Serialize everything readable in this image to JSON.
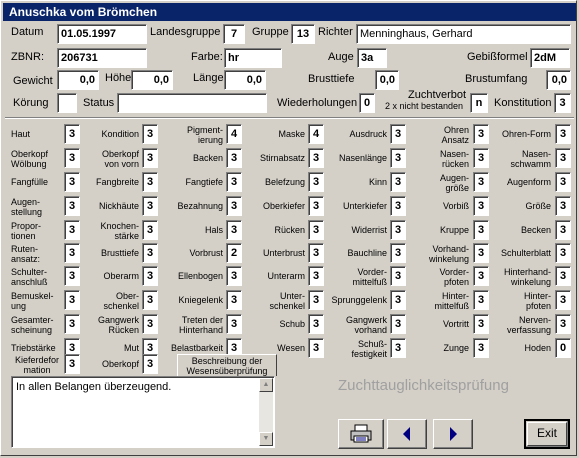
{
  "window": {
    "title": "Anuschka vom Brömchen"
  },
  "header": {
    "datum": {
      "label": "Datum",
      "value": "01.05.1997"
    },
    "landesgruppe": {
      "label": "Landesgruppe",
      "value": "7"
    },
    "gruppe": {
      "label": "Gruppe",
      "value": "13"
    },
    "richter": {
      "label": "Richter",
      "value": "Menninghaus, Gerhard"
    },
    "zbnr": {
      "label": "ZBNR:",
      "value": "206731"
    },
    "farbe": {
      "label": "Farbe:",
      "value": "hr"
    },
    "auge": {
      "label": "Auge",
      "value": "3a"
    },
    "gebissformel": {
      "label": "Gebißformel",
      "value": "2dM"
    },
    "gewicht": {
      "label": "Gewicht",
      "value": "0,0"
    },
    "hoehe": {
      "label": "Höhe",
      "value": "0,0"
    },
    "laenge": {
      "label": "Länge",
      "value": "0,0"
    },
    "brusttiefe": {
      "label": "Brusttiefe",
      "value": "0,0"
    },
    "brustumfang": {
      "label": "Brustumfang",
      "value": "0,0"
    },
    "koerung": {
      "label": "Körung",
      "value": ""
    },
    "status": {
      "label": "Status",
      "value": ""
    },
    "wiederholungen": {
      "label": "Wiederholungen",
      "value": "0"
    },
    "zuchtverbot": {
      "label": "Zuchtverbot",
      "sublabel": "2 x nicht bestanden",
      "value": "n"
    },
    "konstitution": {
      "label": "Konstitution",
      "value": "3"
    }
  },
  "grid": [
    [
      {
        "label": "Haut",
        "value": "3"
      },
      {
        "label": "Kondition",
        "value": "3"
      },
      {
        "label": "Pigment-\nierung",
        "value": "4"
      },
      {
        "label": "Maske",
        "value": "4"
      },
      {
        "label": "Ausdruck",
        "value": "3"
      },
      {
        "label": "Ohren\nAnsatz",
        "value": "3"
      },
      {
        "label": "Ohren-Form",
        "value": "3"
      }
    ],
    [
      {
        "label": "Oberkopf\nWölbung",
        "value": "3"
      },
      {
        "label": "Oberkopf\nvon vorn",
        "value": "3"
      },
      {
        "label": "Backen",
        "value": "3"
      },
      {
        "label": "Stirnabsatz",
        "value": "3"
      },
      {
        "label": "Nasenlänge",
        "value": "3"
      },
      {
        "label": "Nasen-\nrücken",
        "value": "3"
      },
      {
        "label": "Nasen-\nschwamm",
        "value": "3"
      }
    ],
    [
      {
        "label": "Fangfülle",
        "value": "3"
      },
      {
        "label": "Fangbreite",
        "value": "3"
      },
      {
        "label": "Fangtiefe",
        "value": "3"
      },
      {
        "label": "Belefzung",
        "value": "3"
      },
      {
        "label": "Kinn",
        "value": "3"
      },
      {
        "label": "Augen-\ngröße",
        "value": "3"
      },
      {
        "label": "Augenform",
        "value": "3"
      }
    ],
    [
      {
        "label": "Augen-\nstellung",
        "value": "3"
      },
      {
        "label": "Nickhäute",
        "value": "3"
      },
      {
        "label": "Bezahnung",
        "value": "3"
      },
      {
        "label": "Oberkiefer",
        "value": "3"
      },
      {
        "label": "Unterkiefer",
        "value": "3"
      },
      {
        "label": "Vorbiß",
        "value": "3"
      },
      {
        "label": "Größe",
        "value": "3"
      }
    ],
    [
      {
        "label": "Propor-\ntionen",
        "value": "3"
      },
      {
        "label": "Knochen-\nstärke",
        "value": "3"
      },
      {
        "label": "Hals",
        "value": "3"
      },
      {
        "label": "Rücken",
        "value": "3"
      },
      {
        "label": "Widerrist",
        "value": "3"
      },
      {
        "label": "Kruppe",
        "value": "3"
      },
      {
        "label": "Becken",
        "value": "3"
      }
    ],
    [
      {
        "label": "Ruten-\nansatz:",
        "value": "3"
      },
      {
        "label": "Brusttiefe",
        "value": "3"
      },
      {
        "label": "Vorbrust",
        "value": "2"
      },
      {
        "label": "Unterbrust",
        "value": "3"
      },
      {
        "label": "Bauchline",
        "value": "3"
      },
      {
        "label": "Vorhand-\nwinkelung",
        "value": "3"
      },
      {
        "label": "Schulterblatt",
        "value": "3"
      }
    ],
    [
      {
        "label": "Schulter-\nanschluß",
        "value": "3"
      },
      {
        "label": "Oberarm",
        "value": "3"
      },
      {
        "label": "Ellenbogen",
        "value": "3"
      },
      {
        "label": "Unterarm",
        "value": "3"
      },
      {
        "label": "Vorder-\nmittelfuß",
        "value": "3"
      },
      {
        "label": "Vorder-\npfoten",
        "value": "3"
      },
      {
        "label": "Hinterhand-\nwinkelung",
        "value": "3"
      }
    ],
    [
      {
        "label": "Bemuskel-\nung",
        "value": "3"
      },
      {
        "label": "Ober-\nschenkel",
        "value": "3"
      },
      {
        "label": "Kniegelenk",
        "value": "3"
      },
      {
        "label": "Unter-\nschenkel",
        "value": "3"
      },
      {
        "label": "Sprunggelenk",
        "value": "3"
      },
      {
        "label": "Hinter-\nmittelfuß",
        "value": "3"
      },
      {
        "label": "Hinter-\npfoten",
        "value": "3"
      }
    ],
    [
      {
        "label": "Gesamter-\nscheinung",
        "value": "3"
      },
      {
        "label": "Gangwerk\nRücken",
        "value": "3"
      },
      {
        "label": "Treten der\nHinterhand",
        "value": "3"
      },
      {
        "label": "Schub",
        "value": "3"
      },
      {
        "label": "Gangwerk\nvorhand",
        "value": "3"
      },
      {
        "label": "Vortritt",
        "value": "3"
      },
      {
        "label": "Nerven-\nverfassung",
        "value": "3"
      }
    ],
    [
      {
        "label": "Triebstärke",
        "value": "3"
      },
      {
        "label": "Mut",
        "value": "3"
      },
      {
        "label": "Belastbarkeit",
        "value": "3"
      },
      {
        "label": "Wesen",
        "value": "3"
      },
      {
        "label": "Schuß-\nfestigkeit",
        "value": "3"
      },
      {
        "label": "Zunge",
        "value": "3"
      },
      {
        "label": "Hoden",
        "value": "0"
      }
    ]
  ],
  "extra": {
    "kieferdeformation": {
      "label": "Kieferdefor\nmation",
      "value": "3"
    },
    "oberkopf": {
      "label": "Oberkopf",
      "value": "3"
    }
  },
  "tab": {
    "label": "Beschreibung der\nWesensüberprüfung"
  },
  "memo": {
    "text": "In allen Belangen überzeugend."
  },
  "footer": {
    "title": "Zuchttauglichkeitsprüfung",
    "exit_label": "Exit",
    "icons": {
      "print": "printer-icon",
      "prev": "arrow-left-icon",
      "next": "arrow-right-icon"
    },
    "accent_color": "#0a246a",
    "arrow_color": "#000080"
  }
}
